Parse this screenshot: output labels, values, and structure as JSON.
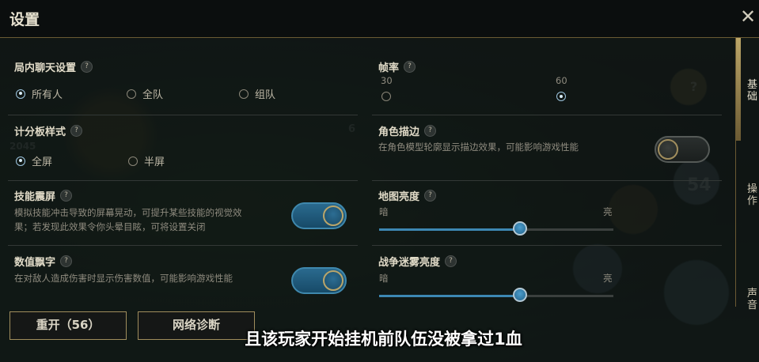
{
  "window": {
    "title": "设置",
    "close_label": "✕"
  },
  "side_tabs": [
    "基础",
    "操作",
    "声音"
  ],
  "chat": {
    "title": "局内聊天设置",
    "help": "?",
    "options": [
      "所有人",
      "全队",
      "组队"
    ],
    "selected": "所有人"
  },
  "scoreboard": {
    "title": "计分板样式",
    "help": "?",
    "options": [
      "全屏",
      "半屏"
    ],
    "selected": "全屏"
  },
  "shake": {
    "title": "技能震屏",
    "help": "?",
    "description_line1": "模拟技能冲击导致的屏幕晃动，可提升某些技能的视觉效",
    "description_line2": "果；若发现此效果令你头晕目眩，可将设置关闭",
    "enabled": true
  },
  "damage_numbers": {
    "title": "数值飘字",
    "help": "?",
    "description": "在对敌人造成伤害时显示伤害数值，可能影响游戏性能",
    "enabled": true
  },
  "framerate": {
    "title": "帧率",
    "help": "?",
    "options": [
      "30",
      "60"
    ],
    "selected": "60"
  },
  "outline": {
    "title": "角色描边",
    "help": "?",
    "description": "在角色模型轮廓显示描边效果，可能影响游戏性能",
    "enabled": false
  },
  "map_brightness": {
    "title": "地图亮度",
    "help": "?",
    "min_label": "暗",
    "max_label": "亮",
    "value": 0.6
  },
  "fog_brightness": {
    "title": "战争迷雾亮度",
    "help": "?",
    "min_label": "暗",
    "max_label": "亮",
    "value": 0.6
  },
  "buttons": {
    "restart": "重开（56）",
    "network": "网络诊断"
  },
  "subtitle": "且该玩家开始挂机前队伍没被拿过1血",
  "background": {
    "score": "2045",
    "badge": "54",
    "badge2": "6",
    "badge3": "?"
  }
}
